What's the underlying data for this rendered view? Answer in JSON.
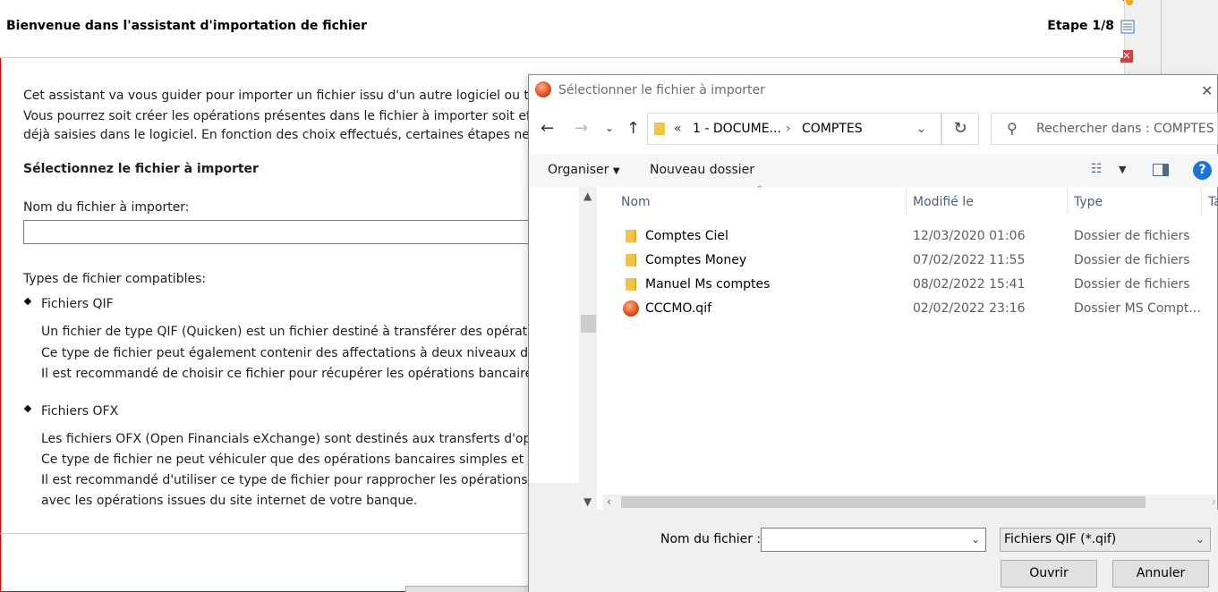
{
  "wizard": {
    "title": "Bienvenue dans l'assistant d'importation de fichier",
    "step": "Etape 1/8",
    "intro": [
      "Cet assistant va vous guider pour importer un fichier issu d'un autre logiciel ou télécha",
      "Vous pourrez soit créer les opérations présentes dans le fichier à importer soit effectu",
      "déjà saisies dans le logiciel. En fonction des choix effectués, certaines étapes ne seron"
    ],
    "select_heading": "Sélectionnez le fichier à importer",
    "filename_label": "Nom du fichier à importer:",
    "filename_value": "",
    "types_heading": "Types de fichier compatibles:",
    "qif": {
      "title": "Fichiers QIF",
      "lines": [
        "Un fichier de type QIF (Quicken) est un fichier destiné à transférer des opérations b",
        "Ce type de fichier peut également contenir des affectations à deux niveaux de caté",
        "Il est recommandé de choisir ce fichier pour récupérer les opérations bancaires et l"
      ]
    },
    "ofx": {
      "title": "Fichiers OFX",
      "lines": [
        "Les fichiers OFX (Open Financials eXchange) sont destinés aux transferts d'opératio",
        "Ce type de fichier ne peut véhiculer que des opérations bancaires simples et ne pe",
        "Il est recommandé d'utiliser ce type de fichier pour rapprocher les opérations banc",
        "avec les opérations issues du site internet de votre banque."
      ]
    }
  },
  "dialog": {
    "title": "Sélectionner le fichier à importer",
    "address": {
      "overflow": "«",
      "crumbs": [
        "1 - DOCUME...",
        "COMPTES"
      ]
    },
    "search_placeholder": "Rechercher dans : COMPTES",
    "toolbar": {
      "organize": "Organiser",
      "new_folder": "Nouveau dossier"
    },
    "columns": [
      "Nom",
      "Modifié le",
      "Type",
      "Ta"
    ],
    "files": [
      {
        "name": "Comptes Ciel",
        "modified": "12/03/2020 01:06",
        "type": "Dossier de fichiers",
        "icon": "folder-icon"
      },
      {
        "name": "Comptes Money",
        "modified": "07/02/2022 11:55",
        "type": "Dossier de fichiers",
        "icon": "folder-icon"
      },
      {
        "name": "Manuel Ms comptes",
        "modified": "08/02/2022 15:41",
        "type": "Dossier de fichiers",
        "icon": "folder-icon"
      },
      {
        "name": "CCCMO.qif",
        "modified": "02/02/2022 23:16",
        "type": "Dossier MS Compt...",
        "icon": "qif-file-icon"
      }
    ],
    "filename_label": "Nom du fichier :",
    "filename_value": "",
    "filter": "Fichiers QIF (*.qif)",
    "open_label": "Ouvrir",
    "cancel_label": "Annuler"
  }
}
